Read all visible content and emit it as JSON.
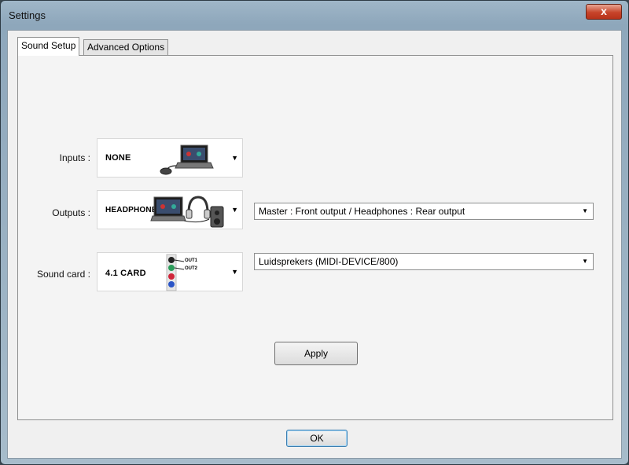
{
  "window": {
    "title": "Settings",
    "close_glyph": "x"
  },
  "tabs": [
    {
      "label": "Sound Setup",
      "active": true
    },
    {
      "label": "Advanced Options",
      "active": false
    }
  ],
  "inputs": {
    "label": "Inputs :",
    "device": "NONE",
    "icon": "laptop-turntable-icon"
  },
  "outputs": {
    "label": "Outputs :",
    "device": "HEADPHONES",
    "icon": "laptop-headphones-speaker-icon",
    "routing_value": "Master : Front output / Headphones : Rear output"
  },
  "sound_card": {
    "label": "Sound card :",
    "device": "4.1 CARD",
    "icon": "audio-jacks-icon",
    "jack_out1": "OUT1",
    "jack_out2": "OUT2",
    "device_value": "Luidsprekers (MIDI-DEVICE/800)"
  },
  "buttons": {
    "apply": "Apply",
    "ok": "OK"
  },
  "colors": {
    "title_bar": "#9fb6c8",
    "close_button": "#c7442a",
    "default_button_border": "#3c7fb1"
  }
}
